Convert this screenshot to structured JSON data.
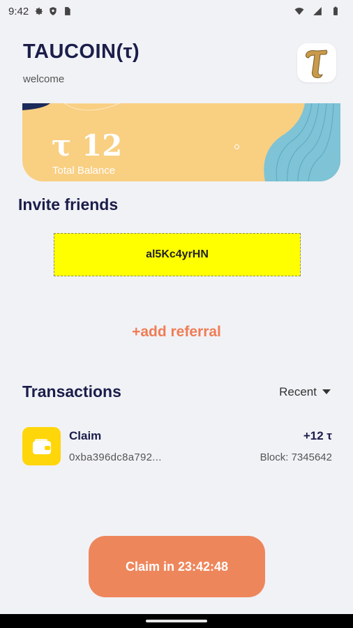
{
  "status_bar": {
    "time": "9:42"
  },
  "header": {
    "title": "TAUCOIN(τ)",
    "subtitle": "welcome"
  },
  "balance": {
    "amount": "τ 12",
    "label": "Total Balance"
  },
  "invite": {
    "title": "Invite friends",
    "code": "al5Kc4yrHN",
    "add_label": "+add referral"
  },
  "transactions": {
    "title": "Transactions",
    "filter": "Recent",
    "items": [
      {
        "name": "Claim",
        "hash": "0xba396dc8a792...",
        "amount": "+12 τ",
        "block": "Block: 7345642"
      }
    ]
  },
  "claim_button": {
    "label": "Claim in 23:42:48"
  },
  "colors": {
    "accent": "#ee865c",
    "card": "#f9cf82",
    "code_bg": "#ffff00",
    "tx_icon": "#ffd60a",
    "title": "#1b1d4a"
  },
  "icons": [
    "settings-icon",
    "shield-icon",
    "sim-icon",
    "wifi-icon",
    "signal-icon",
    "battery-icon",
    "tau-logo-icon",
    "wallet-icon",
    "caret-down-icon"
  ]
}
